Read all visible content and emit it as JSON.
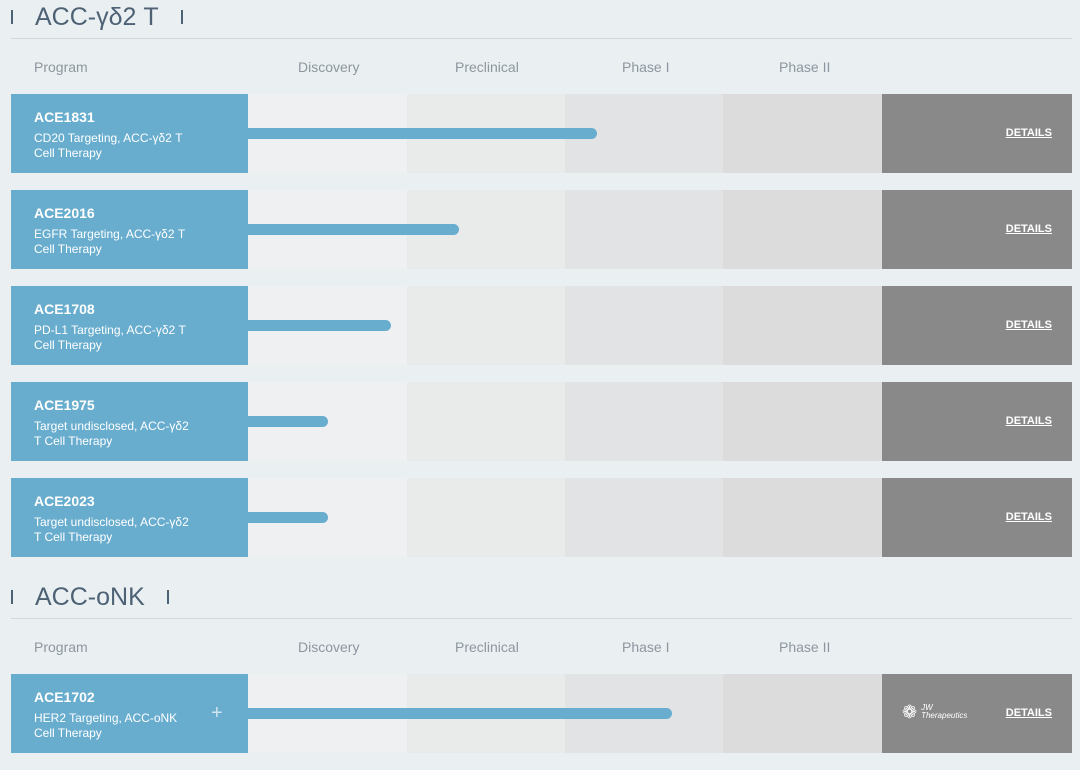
{
  "columns": [
    "Program",
    "Discovery",
    "Preclinical",
    "Phase I",
    "Phase II"
  ],
  "details_label": "DETAILS",
  "colors": {
    "program": "#68adce",
    "details": "#898989",
    "background": "#eaeff2"
  },
  "sections": [
    {
      "title": "ACC-γδ2 T",
      "programs": [
        {
          "name": "ACE1831",
          "desc": "CD20 Targeting, ACC-γδ2 T Cell Therapy",
          "progress": 0.55
        },
        {
          "name": "ACE2016",
          "desc": "EGFR Targeting, ACC-γδ2 T Cell Therapy",
          "progress": 0.333
        },
        {
          "name": "ACE1708",
          "desc": "PD-L1 Targeting, ACC-γδ2 T Cell Therapy",
          "progress": 0.226
        },
        {
          "name": "ACE1975",
          "desc": "Target undisclosed, ACC-γδ2 T Cell Therapy",
          "progress": 0.126
        },
        {
          "name": "ACE2023",
          "desc": "Target undisclosed, ACC-γδ2 T Cell Therapy",
          "progress": 0.126
        }
      ]
    },
    {
      "title": "ACC-oNK",
      "programs": [
        {
          "name": "ACE1702",
          "desc": "HER2 Targeting, ACC-oNK Cell Therapy",
          "progress": 0.669,
          "expand": "+",
          "partner": "JW Therapeutics"
        }
      ]
    }
  ]
}
